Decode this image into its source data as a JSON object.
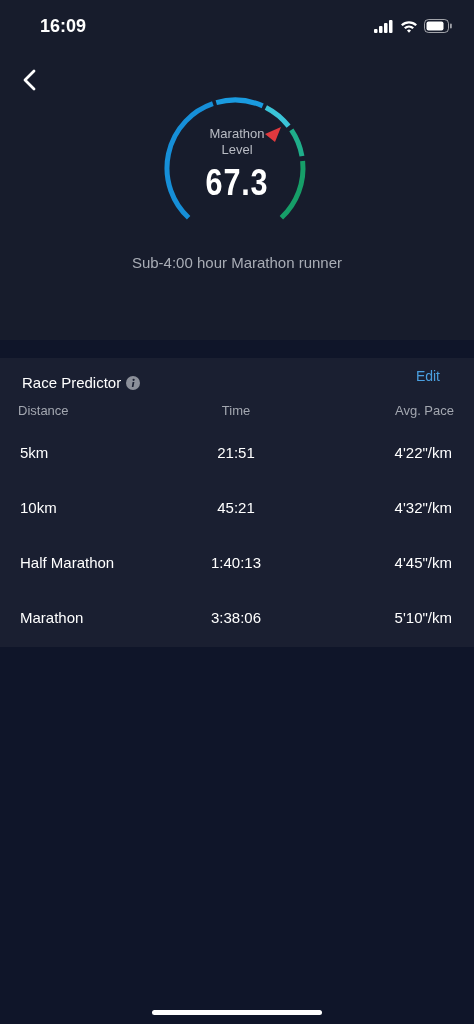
{
  "status_bar": {
    "time": "16:09"
  },
  "gauge": {
    "label": "Marathon Level",
    "value": "67.3",
    "caption": "Sub-4:00 hour Marathon runner"
  },
  "race_predictor": {
    "title": "Race Predictor",
    "edit": "Edit",
    "columns": [
      "Distance",
      "Time",
      "Avg. Pace"
    ],
    "rows": [
      {
        "distance": "5km",
        "time": "21:51",
        "pace": "4'22\"/km"
      },
      {
        "distance": "10km",
        "time": "45:21",
        "pace": "4'32\"/km"
      },
      {
        "distance": "Half Marathon",
        "time": "1:40:13",
        "pace": "4'45\"/km"
      },
      {
        "distance": "Marathon",
        "time": "3:38:06",
        "pace": "5'10\"/km"
      }
    ]
  }
}
